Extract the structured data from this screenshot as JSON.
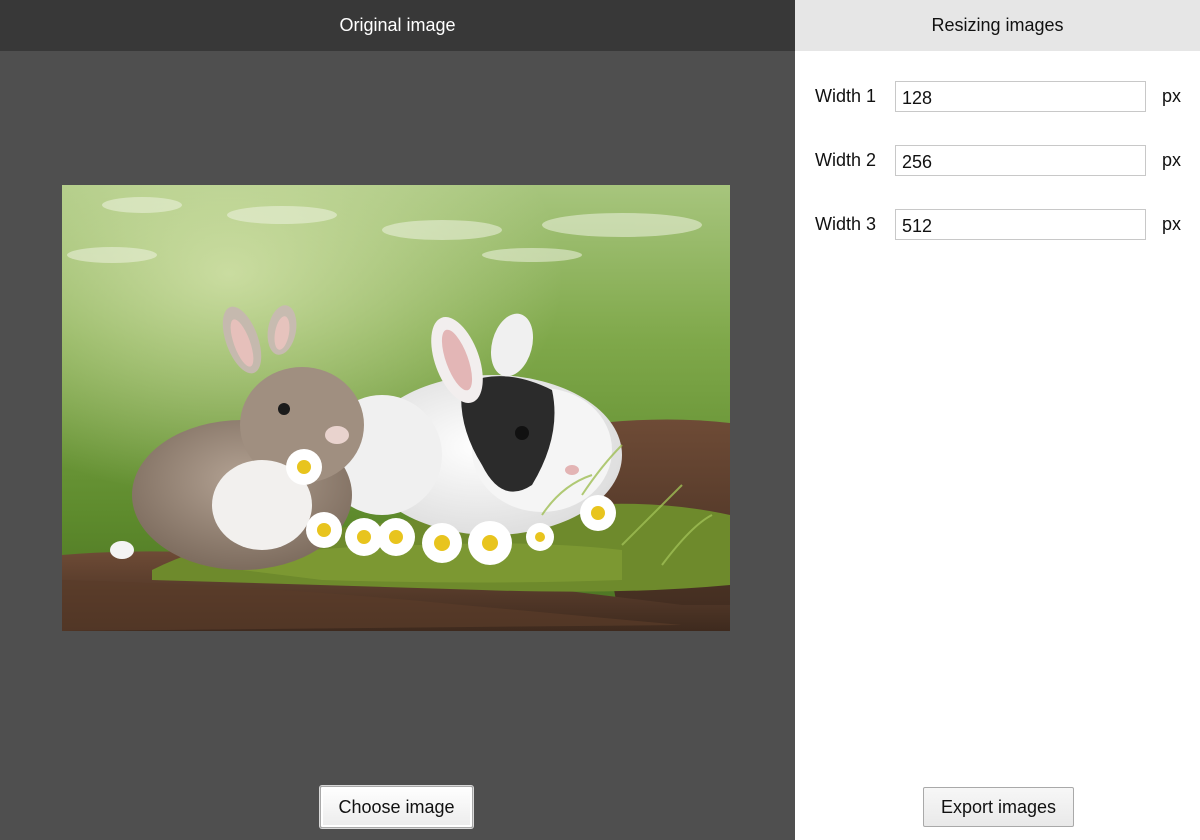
{
  "left_panel": {
    "title": "Original image",
    "preview_icon": "image-preview",
    "choose_button_label": "Choose image"
  },
  "right_panel": {
    "title": "Resizing images",
    "widths": [
      {
        "label": "Width 1",
        "value": "128",
        "unit": "px"
      },
      {
        "label": "Width 2",
        "value": "256",
        "unit": "px"
      },
      {
        "label": "Width 3",
        "value": "512",
        "unit": "px"
      }
    ],
    "export_button_label": "Export images"
  },
  "colors": {
    "left_bg": "#4f4f4f",
    "left_header_bg": "#383838",
    "right_header_bg": "#e6e6e6"
  }
}
